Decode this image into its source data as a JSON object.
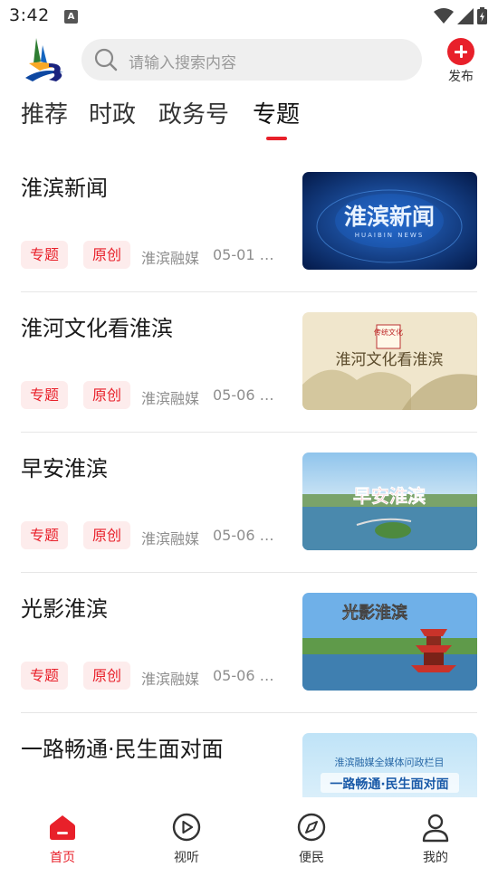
{
  "status_bar": {
    "time": "3:42"
  },
  "header": {
    "search_placeholder": "请输入搜索内容",
    "publish_label": "发布"
  },
  "tabs": [
    {
      "label": "推荐",
      "active": false
    },
    {
      "label": "时政",
      "active": false
    },
    {
      "label": "政务号",
      "active": false
    },
    {
      "label": "专题",
      "active": true
    }
  ],
  "news": [
    {
      "title": "淮滨新闻",
      "tags": [
        "专题",
        "原创"
      ],
      "source": "淮滨融媒",
      "time": "05-01 0...",
      "thumb_text": "淮滨新闻",
      "thumb_subtext": "HUAIBIN NEWS"
    },
    {
      "title": "淮河文化看淮滨",
      "tags": [
        "专题",
        "原创"
      ],
      "source": "淮滨融媒",
      "time": "05-06 1...",
      "thumb_text": "淮河文化看淮滨",
      "thumb_subtext": "传统文化"
    },
    {
      "title": "早安淮滨",
      "tags": [
        "专题",
        "原创"
      ],
      "source": "淮滨融媒",
      "time": "05-06 1...",
      "thumb_text": "早安淮滨",
      "thumb_subtext": ""
    },
    {
      "title": "光影淮滨",
      "tags": [
        "专题",
        "原创"
      ],
      "source": "淮滨融媒",
      "time": "05-06 1...",
      "thumb_text": "光影淮滨",
      "thumb_subtext": ""
    },
    {
      "title": "一路畅通·民生面对面",
      "tags": [],
      "source": "",
      "time": "",
      "thumb_text": "一路畅通·民生面对面",
      "thumb_subtext": "淮滨融媒全媒体问政栏目"
    }
  ],
  "bottom_nav": [
    {
      "label": "首页",
      "icon": "home-icon",
      "active": true
    },
    {
      "label": "视听",
      "icon": "play-icon",
      "active": false
    },
    {
      "label": "便民",
      "icon": "compass-icon",
      "active": false
    },
    {
      "label": "我的",
      "icon": "user-icon",
      "active": false
    }
  ],
  "colors": {
    "accent": "#e8202a",
    "tag_bg": "#fdecec"
  }
}
